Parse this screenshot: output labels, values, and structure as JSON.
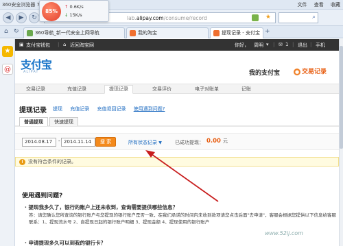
{
  "browser": {
    "title": "360安全浏览器 7.1",
    "menus": [
      "文件",
      "查看",
      "收藏"
    ],
    "speed": {
      "percent": "85%",
      "upload": "0.6K/s",
      "download": "15K/s"
    },
    "url_prefix": "lab.",
    "url_domain": "alipay.com",
    "url_path": "/consume/record",
    "tabs": [
      {
        "label": "360导航_新一代安全上网导航",
        "icon_color": "#6aa84f"
      },
      {
        "label": "我的淘宝",
        "icon_color": "#f07030"
      },
      {
        "label": "提现记录 - 支付宝",
        "icon_color": "#f07030",
        "active": true
      }
    ],
    "home_icon": "⌂",
    "refresh_icon": "↻",
    "newtab_icon": "+"
  },
  "topbar": {
    "wallet": "支付宝钱包",
    "back_taobao": "近回淘宝网",
    "greeting": "你好，",
    "user": "周明",
    "msg_count": "1",
    "logout": "退出",
    "mobile": "手机"
  },
  "header": {
    "logo_text": "支付宝",
    "logo_sub": "ALIPAY",
    "my_alipay": "我的支付宝",
    "trans_records": "交易记录"
  },
  "mainnav": [
    "交易记录",
    "充值记录",
    "提现记录",
    "交易评价",
    "电子对账单",
    "记账"
  ],
  "page": {
    "heading": "提现记录",
    "sublinks": [
      "提现",
      "充值记录",
      "充值退回记录"
    ],
    "help_link": "使用遇到问题?",
    "subtabs": [
      "普通提现",
      "快速提现"
    ],
    "date_from": "2014.08.17",
    "date_to": "2014.11.14",
    "search_label": "搜 索",
    "status_filter": "所有状态记录",
    "success_label": "已成功提现：",
    "success_amount": "0.00",
    "currency": "元",
    "notice": "没有符合条件的记录。"
  },
  "help": {
    "title": "使用遇到问题?",
    "q1": "· 提现我多久了，银行的账户上还未收到，查询需要提供哪些信息？",
    "a1": "答：请您确认您所查询的银行账户与您提现的银行账户是否一致，在我们承诺的时间内未收到款项请您点击后面\"去申请\"，客服会根据您提供以下信息给客服联系：1、提现流水号 2、自提现日起的银行账户明细 3、提现金额 4、提现使用的银行账户",
    "q2": "· 申请提现多久可以到我的银行卡？"
  },
  "watermark": "www.52ij.com",
  "colors": {
    "accent": "#f48a1c",
    "link": "#1b6ac0",
    "brand": "#1b76c9",
    "arrow": "#c81e1e"
  }
}
